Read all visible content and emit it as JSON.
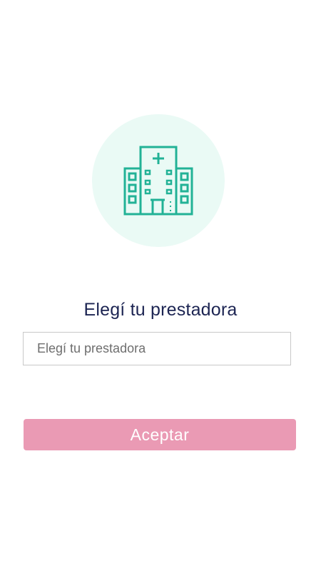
{
  "hero": {
    "icon": "hospital-building-icon",
    "circle_color": "#eafaf5",
    "icon_color": "#22b296"
  },
  "title": "Elegí tu prestadora",
  "provider_input": {
    "placeholder": "Elegí tu prestadora",
    "value": ""
  },
  "accept_button": {
    "label": "Aceptar",
    "color": "#ea9ab4"
  }
}
